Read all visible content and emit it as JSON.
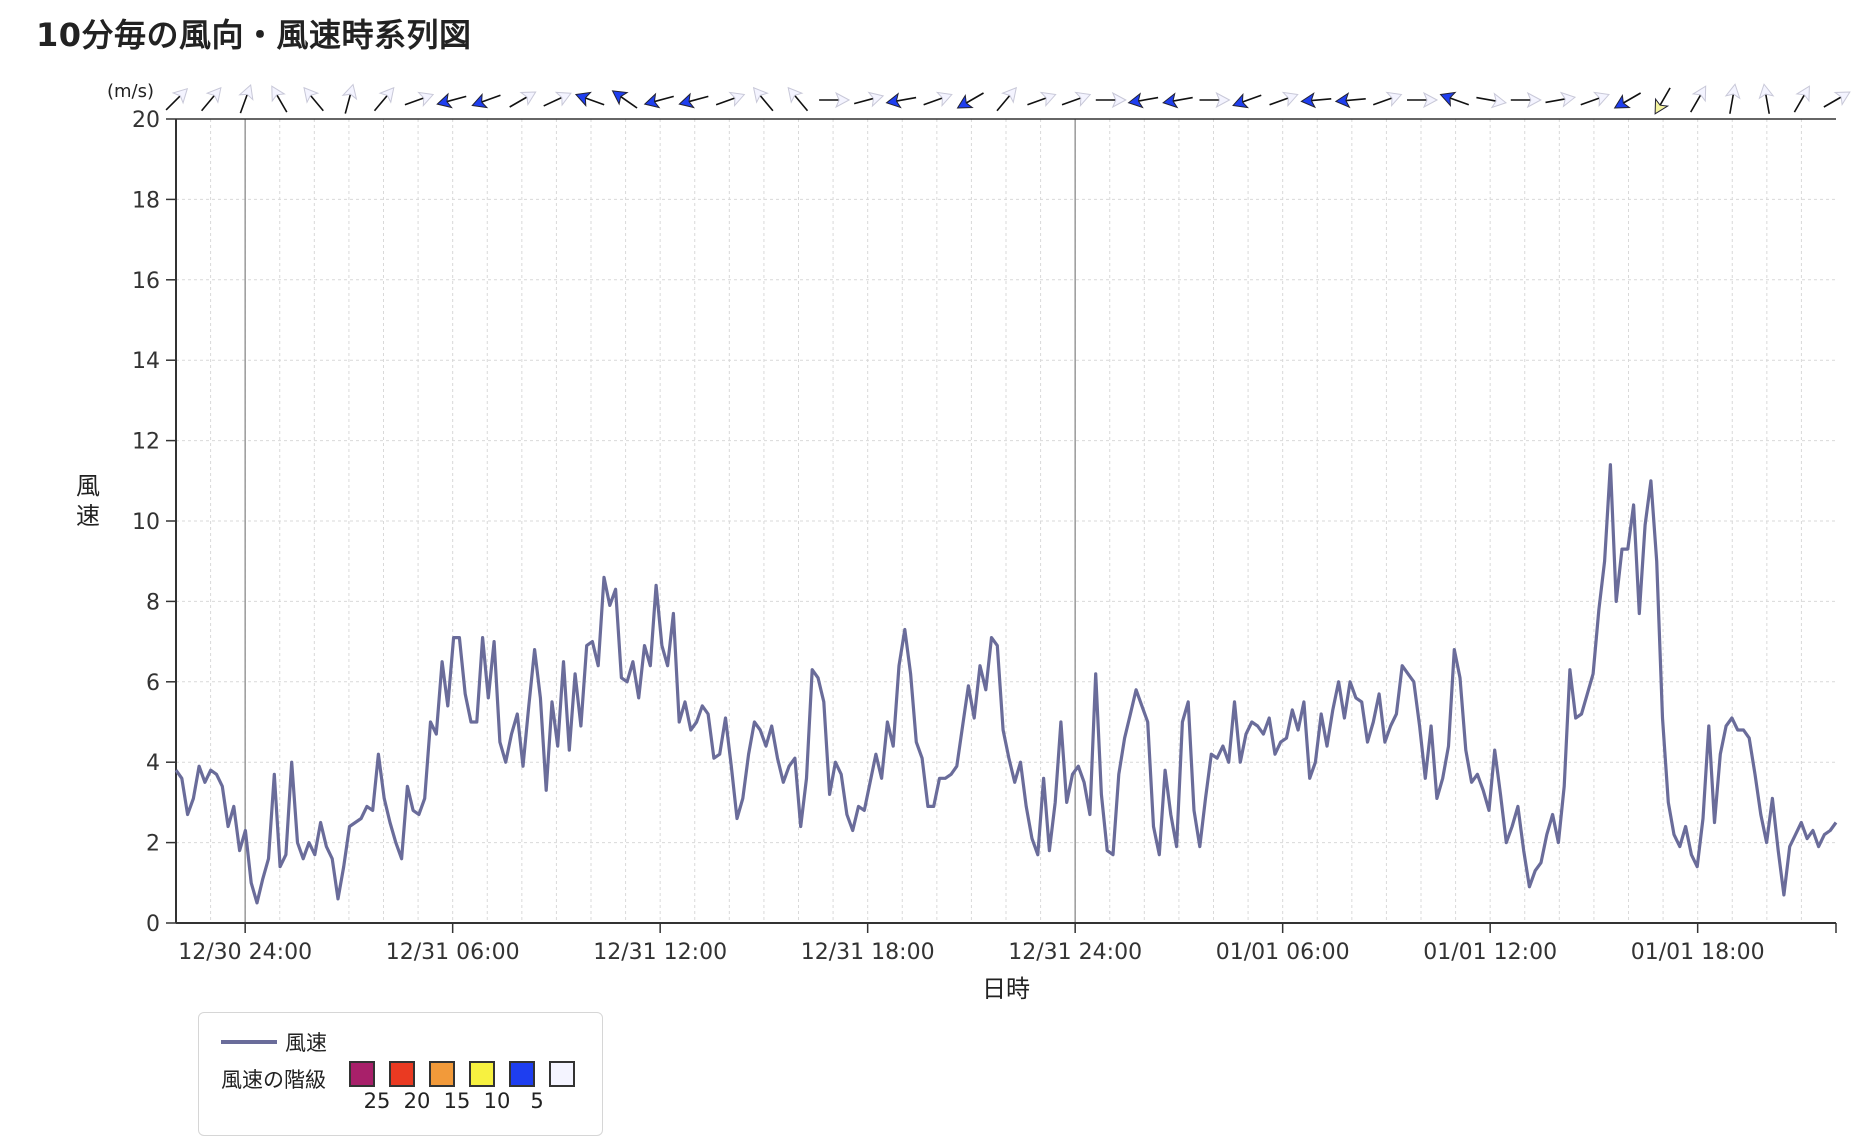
{
  "title": "10分毎の風向・風速時系列図",
  "chart_data": {
    "type": "line",
    "title": "10分毎の風向・風速時系列図",
    "xlabel": "日時",
    "ylabel": "風速",
    "yunit": "(m/s)",
    "ylim": [
      0,
      20
    ],
    "yticks": [
      0,
      2,
      4,
      6,
      8,
      10,
      12,
      14,
      16,
      18,
      20
    ],
    "xlim": [
      "12/30 22:00",
      "01/01 22:00"
    ],
    "xticks": [
      "12/30 24:00",
      "12/31 06:00",
      "12/31 12:00",
      "12/31 18:00",
      "12/31 24:00",
      "01/01 06:00",
      "01/01 12:00",
      "01/01 18:00"
    ],
    "x_interval": "10分",
    "grid": true,
    "series": [
      {
        "name": "風速",
        "color": "#6a6c9a",
        "values": [
          3.8,
          3.6,
          2.7,
          3.1,
          3.9,
          3.5,
          3.8,
          3.7,
          3.4,
          2.4,
          2.9,
          1.8,
          2.3,
          1.0,
          0.5,
          1.1,
          1.6,
          3.7,
          1.4,
          1.7,
          4.0,
          2.0,
          1.6,
          2.0,
          1.7,
          2.5,
          1.9,
          1.6,
          0.6,
          1.4,
          2.4,
          2.5,
          2.6,
          2.9,
          2.8,
          4.2,
          3.1,
          2.5,
          2.0,
          1.6,
          3.4,
          2.8,
          2.7,
          3.1,
          5.0,
          4.7,
          6.5,
          5.4,
          7.1,
          7.1,
          5.7,
          5.0,
          5.0,
          7.1,
          5.6,
          7.0,
          4.5,
          4.0,
          4.7,
          5.2,
          3.9,
          5.4,
          6.8,
          5.6,
          3.3,
          5.5,
          4.4,
          6.5,
          4.3,
          6.2,
          4.9,
          6.9,
          7.0,
          6.4,
          8.6,
          7.9,
          8.3,
          6.1,
          6.0,
          6.5,
          5.6,
          6.9,
          6.4,
          8.4,
          6.9,
          6.4,
          7.7,
          5.0,
          5.5,
          4.8,
          5.0,
          5.4,
          5.2,
          4.1,
          4.2,
          5.1,
          3.9,
          2.6,
          3.1,
          4.2,
          5.0,
          4.8,
          4.4,
          4.9,
          4.1,
          3.5,
          3.9,
          4.1,
          2.4,
          3.6,
          6.3,
          6.1,
          5.5,
          3.2,
          4.0,
          3.7,
          2.7,
          2.3,
          2.9,
          2.8,
          3.5,
          4.2,
          3.6,
          5.0,
          4.4,
          6.4,
          7.3,
          6.2,
          4.5,
          4.1,
          2.9,
          2.9,
          3.6,
          3.6,
          3.7,
          3.9,
          4.9,
          5.9,
          5.1,
          6.4,
          5.8,
          7.1,
          6.9,
          4.8,
          4.1,
          3.5,
          4.0,
          2.9,
          2.1,
          1.7,
          3.6,
          1.8,
          3.0,
          5.0,
          3.0,
          3.7,
          3.9,
          3.5,
          2.7,
          6.2,
          3.2,
          1.8,
          1.7,
          3.7,
          4.6,
          5.2,
          5.8,
          5.4,
          5.0,
          2.4,
          1.7,
          3.8,
          2.7,
          1.9,
          5.0,
          5.5,
          2.8,
          1.9,
          3.1,
          4.2,
          4.1,
          4.4,
          4.0,
          5.5,
          4.0,
          4.7,
          5.0,
          4.9,
          4.7,
          5.1,
          4.2,
          4.5,
          4.6,
          5.3,
          4.8,
          5.5,
          3.6,
          4.0,
          5.2,
          4.4,
          5.3,
          6.0,
          5.1,
          6.0,
          5.6,
          5.5,
          4.5,
          5.0,
          5.7,
          4.5,
          4.9,
          5.2,
          6.4,
          6.2,
          6.0,
          4.9,
          3.6,
          4.9,
          3.1,
          3.6,
          4.4,
          6.8,
          6.1,
          4.3,
          3.5,
          3.7,
          3.3,
          2.8,
          4.3,
          3.2,
          2.0,
          2.4,
          2.9,
          1.8,
          0.9,
          1.3,
          1.5,
          2.2,
          2.7,
          2.0,
          3.4,
          6.3,
          5.1,
          5.2,
          5.7,
          6.2,
          7.8,
          9.0,
          11.4,
          8.0,
          9.3,
          9.3,
          10.4,
          7.7,
          9.9,
          11.0,
          9.0,
          5.1,
          3.0,
          2.2,
          1.9,
          2.4,
          1.7,
          1.4,
          2.6,
          4.9,
          2.5,
          4.2,
          4.9,
          5.1,
          4.8,
          4.8,
          4.6,
          3.7,
          2.7,
          2.0,
          3.1,
          1.8,
          0.7,
          1.9,
          2.2,
          2.5,
          2.1,
          2.3,
          1.9,
          2.2,
          2.3,
          2.5
        ]
      }
    ],
    "wind_direction": {
      "interval": "1時間",
      "arrow_colors": [
        "#f4f4ff",
        "#f4f4ff",
        "#f4f4ff",
        "#f4f4ff",
        "#f4f4ff",
        "#f4f4ff",
        "#f4f4ff",
        "#f4f4ff",
        "#1e3ef0",
        "#1e3ef0",
        "#f4f4ff",
        "#f4f4ff",
        "#1e3ef0",
        "#1e3ef0",
        "#1e3ef0",
        "#1e3ef0",
        "#f4f4ff",
        "#f4f4ff",
        "#f4f4ff",
        "#f4f4ff",
        "#f4f4ff",
        "#1e3ef0",
        "#f4f4ff",
        "#1e3ef0",
        "#f4f4ff",
        "#f4f4ff",
        "#f4f4ff",
        "#f4f4ff",
        "#1e3ef0",
        "#1e3ef0",
        "#f4f4ff",
        "#1e3ef0",
        "#f4f4ff",
        "#1e3ef0",
        "#1e3ef0",
        "#f4f4ff",
        "#f4f4ff",
        "#1e3ef0",
        "#f4f4ff",
        "#f4f4ff",
        "#f4f4ff",
        "#f4f4ff",
        "#1e3ef0",
        "#f4f3a0",
        "#f4f4ff",
        "#f4f4ff",
        "#f4f4ff",
        "#f4f4ff",
        "#f4f4ff"
      ],
      "directions_deg": [
        45,
        40,
        20,
        330,
        320,
        15,
        40,
        70,
        255,
        250,
        60,
        65,
        290,
        305,
        255,
        255,
        70,
        320,
        320,
        90,
        75,
        260,
        70,
        240,
        40,
        70,
        70,
        90,
        260,
        260,
        90,
        250,
        70,
        265,
        265,
        70,
        90,
        290,
        100,
        90,
        80,
        70,
        240,
        210,
        30,
        10,
        350,
        30,
        60
      ]
    }
  },
  "legend": {
    "series_label": "風速",
    "class_label": "風速の階級",
    "classes": [
      {
        "color": "#a8206a",
        "label": "25"
      },
      {
        "color": "#ea3a22",
        "label": "20"
      },
      {
        "color": "#f29a3a",
        "label": "15"
      },
      {
        "color": "#f7f140",
        "label": "10"
      },
      {
        "color": "#1e3ef0",
        "label": "5"
      },
      {
        "color": "#f4f4ff",
        "label": ""
      }
    ]
  }
}
